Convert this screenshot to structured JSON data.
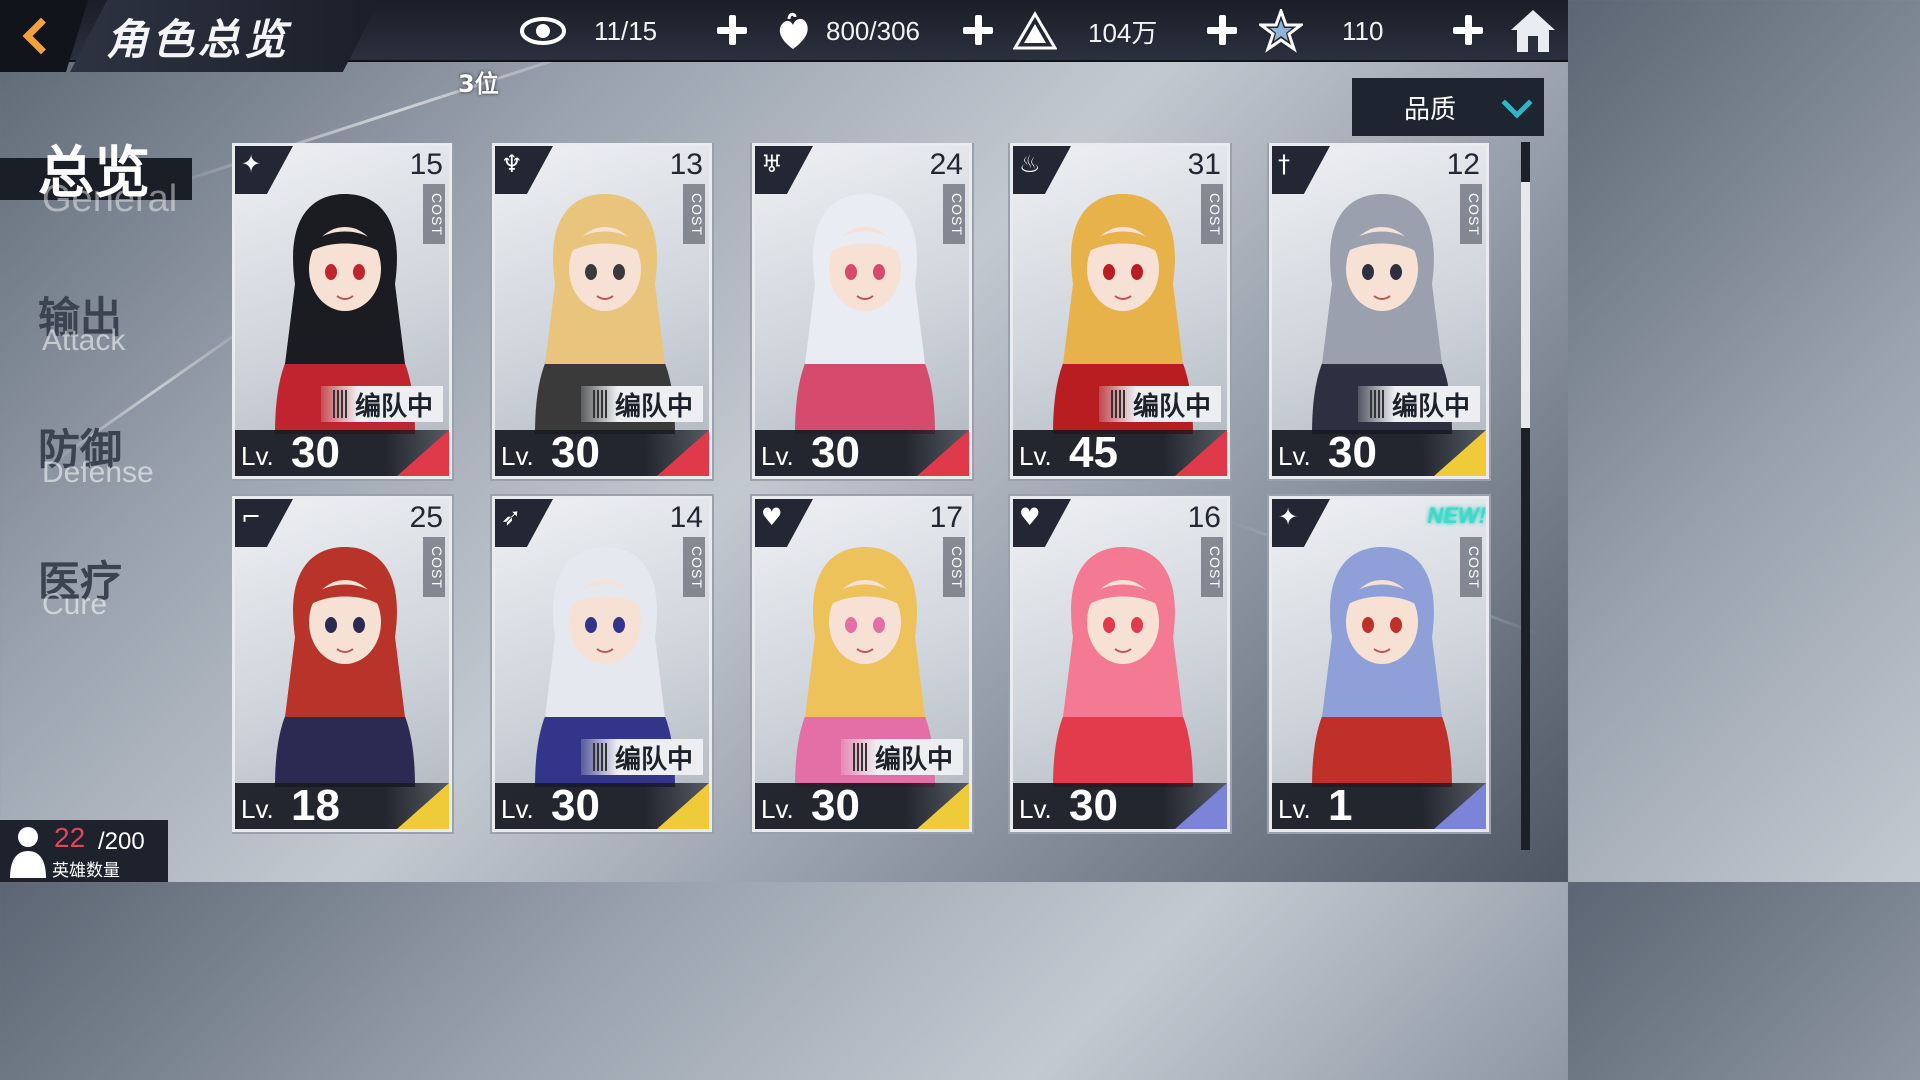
{
  "header": {
    "title": "角色总览",
    "rank_label": "3位",
    "resources": [
      {
        "icon": "eye-icon",
        "value": "11/15"
      },
      {
        "icon": "heart-flame-icon",
        "value": "800/306"
      },
      {
        "icon": "triangle-emblem-icon",
        "value": "104万"
      },
      {
        "icon": "star-icon",
        "value": "110"
      }
    ]
  },
  "sort": {
    "label": "品质"
  },
  "tabs": [
    {
      "cn": "总览",
      "en": "General"
    },
    {
      "cn": "输出",
      "en": "Attack"
    },
    {
      "cn": "防御",
      "en": "Defense"
    },
    {
      "cn": "医疗",
      "en": "Cure"
    }
  ],
  "cards": [
    {
      "cost": "15",
      "cost_label": "COST",
      "lv_prefix": "Lv.",
      "level": "30",
      "in_team": "编队中",
      "class_icon": "shuriken-icon",
      "rarity_color": "#e0394a",
      "hair": "#1b1b22",
      "accent": "#c0242e"
    },
    {
      "cost": "13",
      "cost_label": "COST",
      "lv_prefix": "Lv.",
      "level": "30",
      "in_team": "编队中",
      "class_icon": "dragon-icon",
      "rarity_color": "#e0394a",
      "hair": "#e8c47c",
      "accent": "#3a3a3a"
    },
    {
      "cost": "24",
      "cost_label": "COST",
      "lv_prefix": "Lv.",
      "level": "30",
      "in_team": "",
      "class_icon": "demon-icon",
      "rarity_color": "#e0394a",
      "hair": "#e9ecf2",
      "accent": "#d64a6e"
    },
    {
      "cost": "31",
      "cost_label": "COST",
      "lv_prefix": "Lv.",
      "level": "45",
      "in_team": "编队中",
      "class_icon": "flame-icon",
      "rarity_color": "#e0394a",
      "hair": "#e7b24a",
      "accent": "#b81d22"
    },
    {
      "cost": "12",
      "cost_label": "COST",
      "lv_prefix": "Lv.",
      "level": "30",
      "in_team": "编队中",
      "class_icon": "sword-icon",
      "rarity_color": "#efcb3a",
      "hair": "#9aa0ad",
      "accent": "#2d3040"
    },
    {
      "cost": "25",
      "cost_label": "COST",
      "lv_prefix": "Lv.",
      "level": "18",
      "in_team": "",
      "class_icon": "gun-icon",
      "rarity_color": "#efcb3a",
      "hair": "#b8342a",
      "accent": "#2b2a52"
    },
    {
      "cost": "14",
      "cost_label": "COST",
      "lv_prefix": "Lv.",
      "level": "30",
      "in_team": "编队中",
      "class_icon": "bow-icon",
      "rarity_color": "#efcb3a",
      "hair": "#e6e8ef",
      "accent": "#33358a"
    },
    {
      "cost": "17",
      "cost_label": "COST",
      "lv_prefix": "Lv.",
      "level": "30",
      "in_team": "编队中",
      "class_icon": "winged-heart-icon",
      "rarity_color": "#efcb3a",
      "hair": "#eec25a",
      "accent": "#e46fa6"
    },
    {
      "cost": "16",
      "cost_label": "COST",
      "lv_prefix": "Lv.",
      "level": "30",
      "in_team": "",
      "class_icon": "winged-heart-icon",
      "rarity_color": "#7b84d8",
      "hair": "#f47a93",
      "accent": "#e23b4c"
    },
    {
      "cost": "",
      "cost_label": "COST",
      "lv_prefix": "Lv.",
      "level": "1",
      "in_team": "",
      "class_icon": "shuriken-icon",
      "rarity_color": "#7b84d8",
      "hair": "#8fa0d8",
      "accent": "#c0302b",
      "new_label": "NEW!"
    }
  ],
  "hero_count": {
    "current": "22",
    "max": "/200",
    "label": "英雄数量"
  }
}
